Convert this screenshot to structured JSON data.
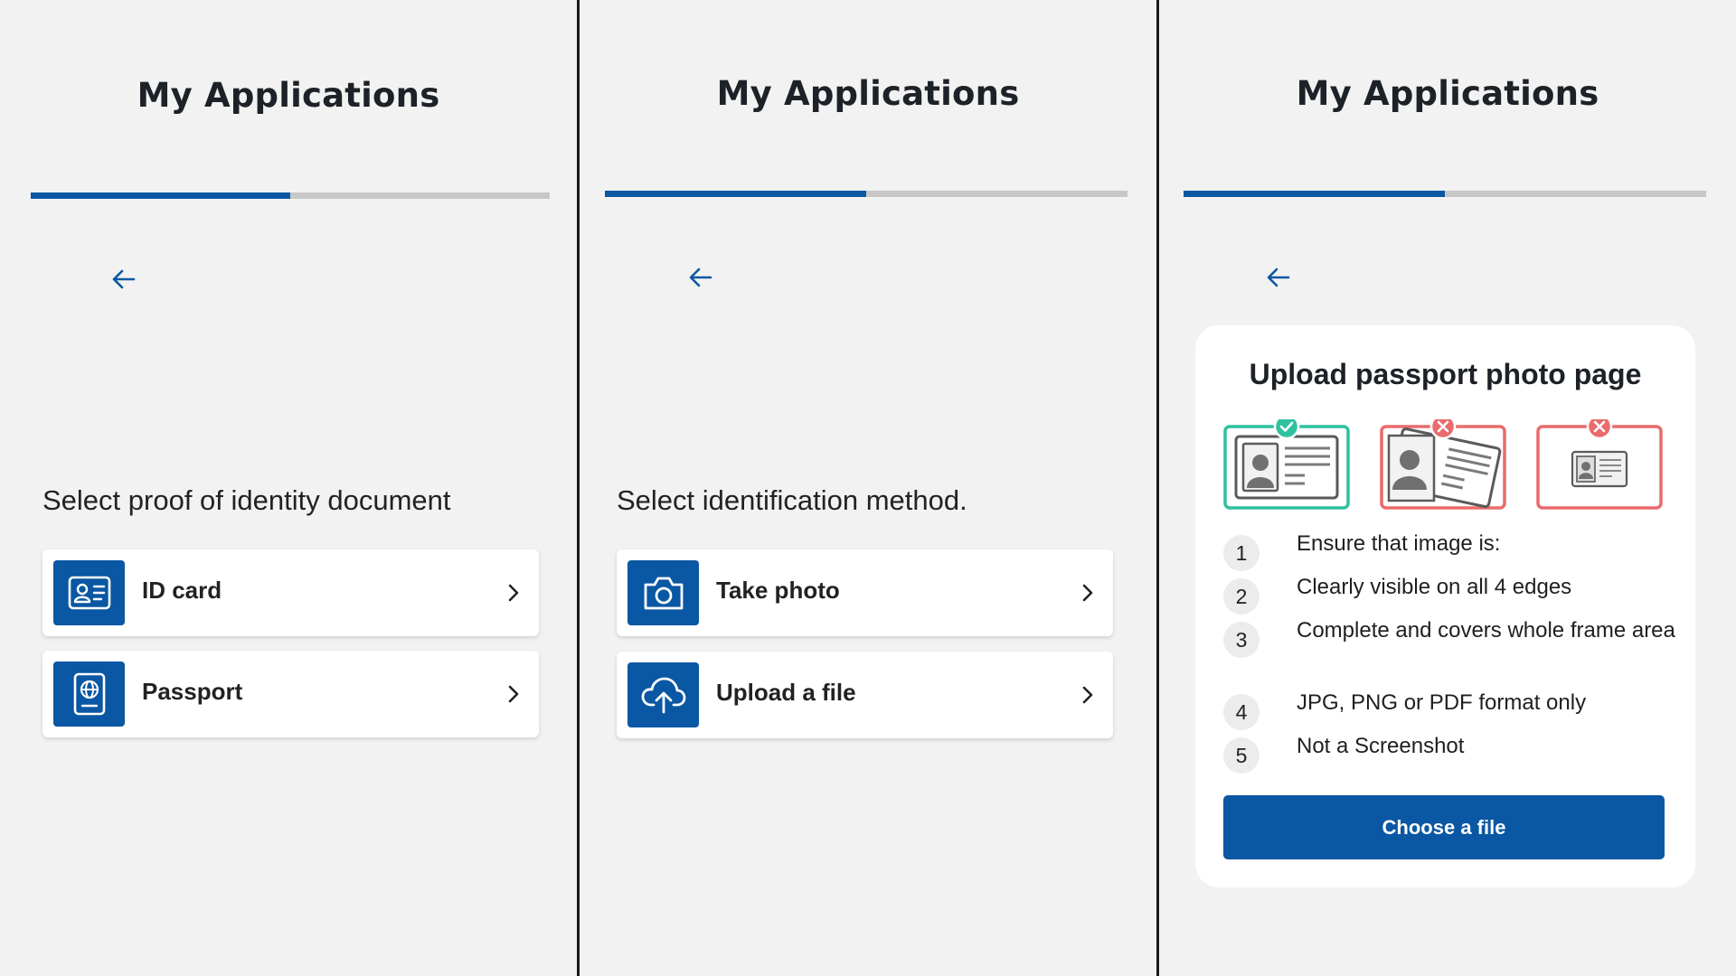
{
  "colors": {
    "brand": "#0a57a3",
    "track": "#c7c7c7",
    "good": "#2fc1a0",
    "bad": "#ea6b6b",
    "background": "#f2f2f2"
  },
  "panels": [
    {
      "title": "My Applications",
      "progress": 0.5,
      "back_icon": "arrow-left-icon",
      "prompt": "Select proof of identity document",
      "options": [
        {
          "label": "ID card",
          "icon": "id-card-icon"
        },
        {
          "label": "Passport",
          "icon": "passport-icon"
        }
      ]
    },
    {
      "title": "My Applications",
      "progress": 0.5,
      "back_icon": "arrow-left-icon",
      "prompt": "Select identification method.",
      "options": [
        {
          "label": "Take photo",
          "icon": "camera-icon"
        },
        {
          "label": "Upload a file",
          "icon": "cloud-upload-icon"
        }
      ]
    },
    {
      "title": "My Applications",
      "progress": 0.5,
      "back_icon": "arrow-left-icon",
      "card": {
        "title": "Upload passport photo page",
        "samples": [
          {
            "status": "correct",
            "icon": "check-icon"
          },
          {
            "status": "tilted",
            "icon": "cross-icon"
          },
          {
            "status": "too-small",
            "icon": "cross-icon"
          }
        ],
        "rules": [
          {
            "num": "1",
            "text": "Ensure that image is:"
          },
          {
            "num": "2",
            "text": "Clearly visible on all 4 edges"
          },
          {
            "num": "3",
            "text": "Complete and covers whole frame area"
          },
          {
            "num": "4",
            "text": "JPG, PNG or PDF format only"
          },
          {
            "num": "5",
            "text": "Not a Screenshot"
          }
        ],
        "button_label": "Choose a file"
      }
    }
  ]
}
